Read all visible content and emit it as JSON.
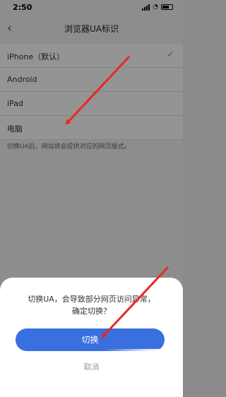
{
  "status": {
    "time": "2:50"
  },
  "nav": {
    "title": "浏览器UA标识"
  },
  "ua_options": [
    {
      "label": "iPhone（默认）",
      "selected": true
    },
    {
      "label": "Android"
    },
    {
      "label": "iPad"
    },
    {
      "label": "电脑"
    }
  ],
  "hint": "切换UA后，网站将会提供对应的网页版式。",
  "dialog": {
    "message_line1": "切换UA，会导致部分网页访问异常，",
    "message_line2": "确定切换？",
    "confirm_label": "切换",
    "cancel_label": "取消"
  },
  "colors": {
    "accent": "#3a6fe0",
    "annotation_arrow": "#e8281f"
  }
}
